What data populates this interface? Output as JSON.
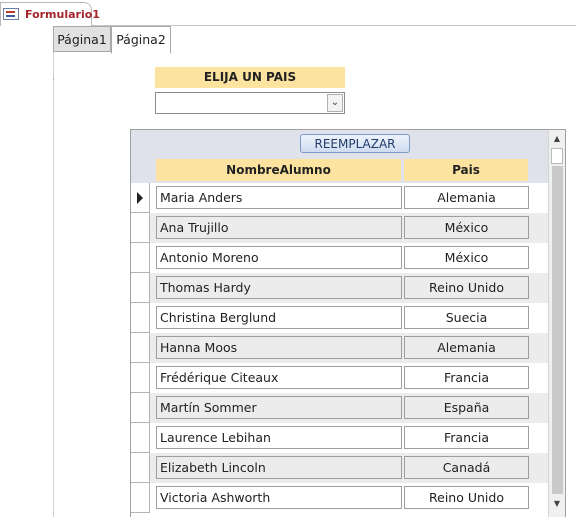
{
  "document_tab": {
    "title": "Formulario1",
    "icon": "form-icon"
  },
  "tabs": [
    {
      "label": "Página1",
      "active": false
    },
    {
      "label": "Página2",
      "active": true
    }
  ],
  "filter": {
    "label": "ELIJA UN PAIS",
    "value": "",
    "arrow": "chevron-down-icon"
  },
  "subform": {
    "button_label": "REEMPLAZAR",
    "columns": [
      "NombreAlumno",
      "Pais"
    ],
    "rows": [
      {
        "name": "Maria Anders",
        "country": "Alemania",
        "current": true
      },
      {
        "name": "Ana Trujillo",
        "country": "México"
      },
      {
        "name": "Antonio Moreno",
        "country": "México"
      },
      {
        "name": "Thomas Hardy",
        "country": "Reino Unido"
      },
      {
        "name": "Christina Berglund",
        "country": "Suecia"
      },
      {
        "name": "Hanna Moos",
        "country": "Alemania"
      },
      {
        "name": "Frédérique Citeaux",
        "country": "Francia"
      },
      {
        "name": "Martín Sommer",
        "country": "España"
      },
      {
        "name": "Laurence Lebihan",
        "country": "Francia"
      },
      {
        "name": "Elizabeth Lincoln",
        "country": "Canadá"
      },
      {
        "name": "Victoria Ashworth",
        "country": "Reino Unido"
      }
    ]
  },
  "colors": {
    "header_fill": "#fce4a0",
    "tab_title": "#a4262c",
    "button_border": "#7d99c4"
  }
}
